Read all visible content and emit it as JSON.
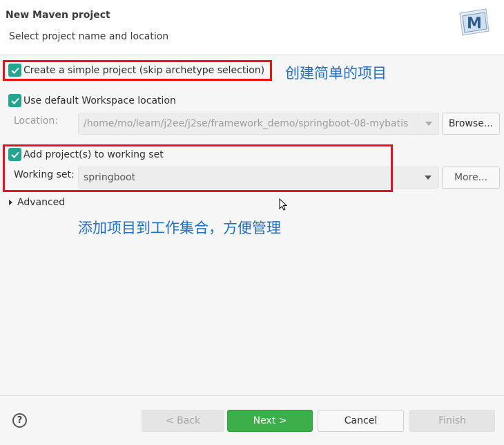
{
  "header": {
    "title": "New Maven project",
    "subtitle": "Select project name and location",
    "logo_icon": "maven-m-icon",
    "logo_letter": "M"
  },
  "options": {
    "simple_project": {
      "label": "Create a simple project (skip archetype selection)",
      "checked": true
    },
    "default_workspace": {
      "label": "Use default Workspace location",
      "checked": true
    },
    "working_set": {
      "label": "Add project(s) to working set",
      "checked": true
    }
  },
  "location": {
    "label": "Location:",
    "value": "/home/mo/learn/j2ee/j2se/framework_demo/springboot-08-mybatis",
    "browse_label": "Browse..."
  },
  "working_set_field": {
    "label": "Working set:",
    "value": "springboot",
    "more_label": "More..."
  },
  "advanced": {
    "label": "Advanced"
  },
  "annotations": {
    "simple_project_note": "创建简单的项目",
    "working_set_note": "添加项目到工作集合，方便管理"
  },
  "footer": {
    "back_label": "< Back",
    "next_label": "Next >",
    "cancel_label": "Cancel",
    "finish_label": "Finish"
  },
  "colors": {
    "accent_check": "#25a58f",
    "primary_button": "#3aaf4a",
    "highlight_box": "#e8121a",
    "annotation_text": "#1f6fc6"
  }
}
